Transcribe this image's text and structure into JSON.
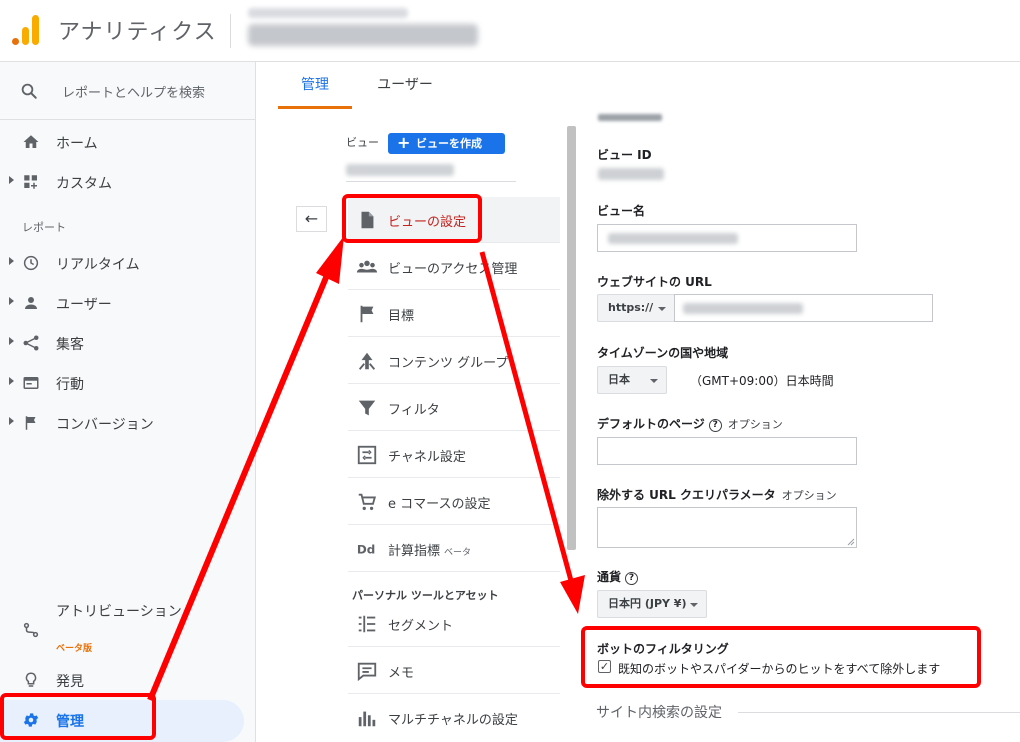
{
  "header": {
    "app_title": "アナリティクス"
  },
  "sidebar": {
    "search_placeholder": "レポートとヘルプを検索",
    "items": [
      {
        "label": "ホーム",
        "icon": "home-icon"
      },
      {
        "label": "カスタム",
        "icon": "dashboard-icon"
      },
      {
        "label": "リアルタイム",
        "icon": "clock-icon"
      },
      {
        "label": "ユーザー",
        "icon": "person-icon"
      },
      {
        "label": "集客",
        "icon": "acquisition-icon"
      },
      {
        "label": "行動",
        "icon": "behavior-icon"
      },
      {
        "label": "コンバージョン",
        "icon": "flag-icon"
      }
    ],
    "section_report": "レポート",
    "attribution_label": "アトリビューション",
    "attribution_beta": "ベータ版",
    "discover_label": "発見",
    "admin_label": "管理"
  },
  "tabs": [
    {
      "label": "管理",
      "active": true
    },
    {
      "label": "ユーザー",
      "active": false
    }
  ],
  "view_column": {
    "view_label": "ビュー",
    "create_button": "ビューを作成",
    "menu": [
      {
        "label": "ビューの設定",
        "icon": "document-icon",
        "active": true
      },
      {
        "label": "ビューのアクセス管理",
        "icon": "people-icon"
      },
      {
        "label": "目標",
        "icon": "flag-icon"
      },
      {
        "label": "コンテンツ グループ",
        "icon": "content-group-icon"
      },
      {
        "label": "フィルタ",
        "icon": "filter-icon"
      },
      {
        "label": "チャネル設定",
        "icon": "channel-icon"
      },
      {
        "label": "e コマースの設定",
        "icon": "cart-icon"
      },
      {
        "label": "計算指標",
        "icon": "dd-icon",
        "badge": "ベータ"
      }
    ],
    "personal_header": "パーソナル ツールとアセット",
    "personal_menu": [
      {
        "label": "セグメント",
        "icon": "segment-icon"
      },
      {
        "label": "メモ",
        "icon": "note-icon"
      },
      {
        "label": "マルチチャネルの設定",
        "icon": "bar-chart-icon"
      }
    ]
  },
  "form": {
    "view_id_label": "ビュー ID",
    "view_name_label": "ビュー名",
    "website_url_label": "ウェブサイトの URL",
    "protocol": "https://",
    "timezone_label": "タイムゾーンの国や地域",
    "timezone_country": "日本",
    "timezone_value": "（GMT+09:00）日本時間",
    "default_page_label": "デフォルトのページ",
    "default_page_optional": "オプション",
    "exclude_params_label": "除外する URL クエリパラメータ",
    "exclude_params_optional": "オプション",
    "currency_label": "通貨",
    "currency_value": "日本円 (JPY ¥)",
    "bot_filter_label": "ボットのフィルタリング",
    "bot_filter_desc": "既知のボットやスパイダーからのヒットをすべて除外します",
    "bot_filter_checked": true,
    "site_search_label": "サイト内検索の設定"
  },
  "colors": {
    "accent_blue": "#1a73e8",
    "tab_underline": "#e8710a",
    "annotation_red": "#ff0000",
    "active_red_text": "#c5221f"
  }
}
